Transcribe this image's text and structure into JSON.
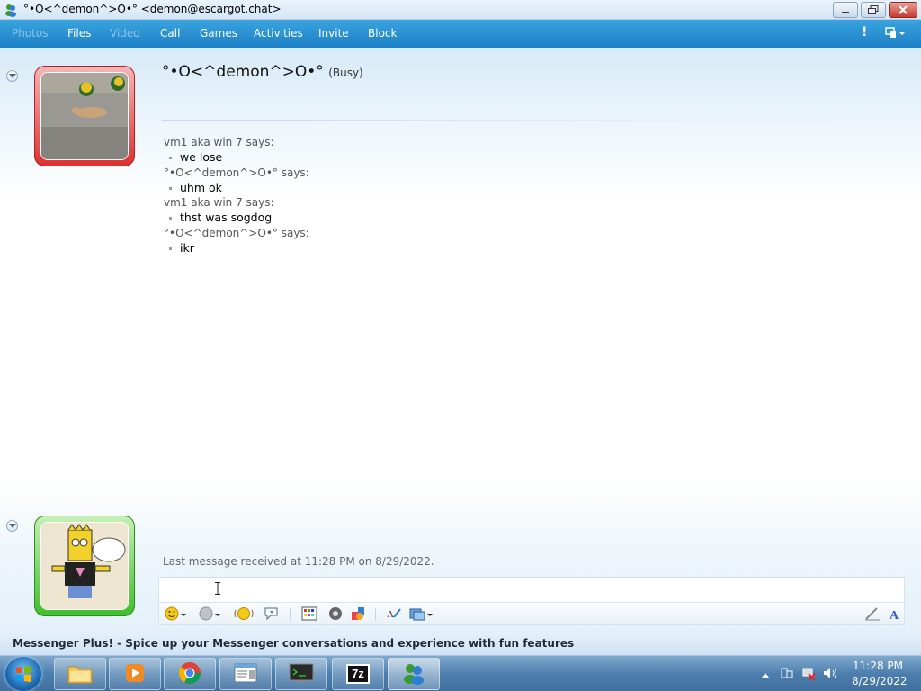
{
  "window": {
    "title": "°•Ο<^demon^>Ο•° <demon@escargot.chat>"
  },
  "menu": {
    "photos": "Photos",
    "files": "Files",
    "video": "Video",
    "call": "Call",
    "games": "Games",
    "activities": "Activities",
    "invite": "Invite",
    "block": "Block",
    "alert_glyph": "!"
  },
  "contact": {
    "name": "°•Ο<^demon^>Ο•°",
    "status": "(Busy)"
  },
  "messages": [
    {
      "sender": "vm1 aka win 7 says:",
      "text": "we lose"
    },
    {
      "sender": "°•Ο<^demon^>Ο•° says:",
      "text": "uhm ok"
    },
    {
      "sender": "vm1 aka win 7 says:",
      "text": "thst was sogdog"
    },
    {
      "sender": "°•Ο<^demon^>Ο•° says:",
      "text": "ikr"
    }
  ],
  "last_received": "Last message received at 11:28 PM on 8/29/2022.",
  "input": {
    "value": "",
    "placeholder": ""
  },
  "toolbar": {
    "icons": [
      "emoticon-icon",
      "wink-icon",
      "nudge-icon",
      "voice-clip-icon",
      "backgrounds-icon",
      "sound-icon",
      "games-icon",
      "handwriting-icon",
      "ink-icon",
      "font-icon"
    ]
  },
  "ad": {
    "text": "Messenger Plus! - Spice up your Messenger conversations and experience with fun features"
  },
  "taskbar": {
    "apps": [
      "explorer",
      "media-player",
      "chrome",
      "notepad",
      "terminal",
      "7zip",
      "messenger"
    ],
    "seven_zip_label": "7z",
    "time": "11:28 PM",
    "date": "8/29/2022"
  },
  "colors": {
    "menubar": "#2a93d6",
    "busy_frame": "#dd2f2f",
    "online_frame": "#3fbf2a"
  }
}
